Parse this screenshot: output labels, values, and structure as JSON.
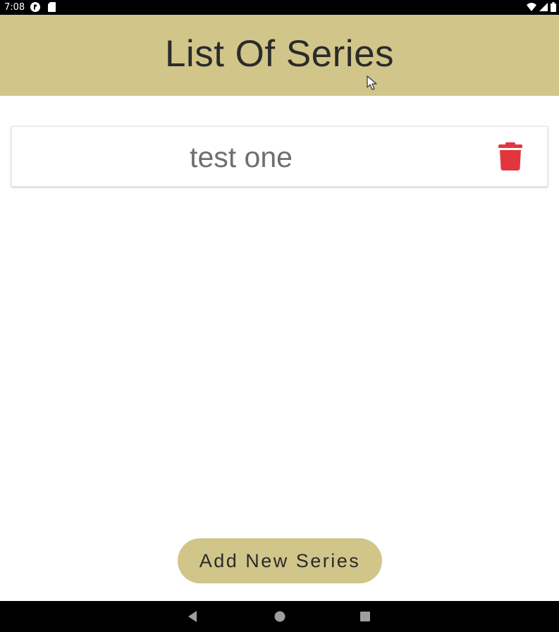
{
  "status_bar": {
    "time": "7:08"
  },
  "header": {
    "title": "List Of Series",
    "background_color": "#d1c58a"
  },
  "series_list": [
    {
      "title": "test one"
    }
  ],
  "add_button": {
    "label": "Add New Series",
    "color": "#d1c58a"
  },
  "icons": {
    "delete": "trash-icon",
    "cursor": "mouse-pointer-icon"
  },
  "colors": {
    "delete_icon": "#e2363f",
    "title_text": "#2b2b2b",
    "item_text": "#6f6f6f"
  }
}
